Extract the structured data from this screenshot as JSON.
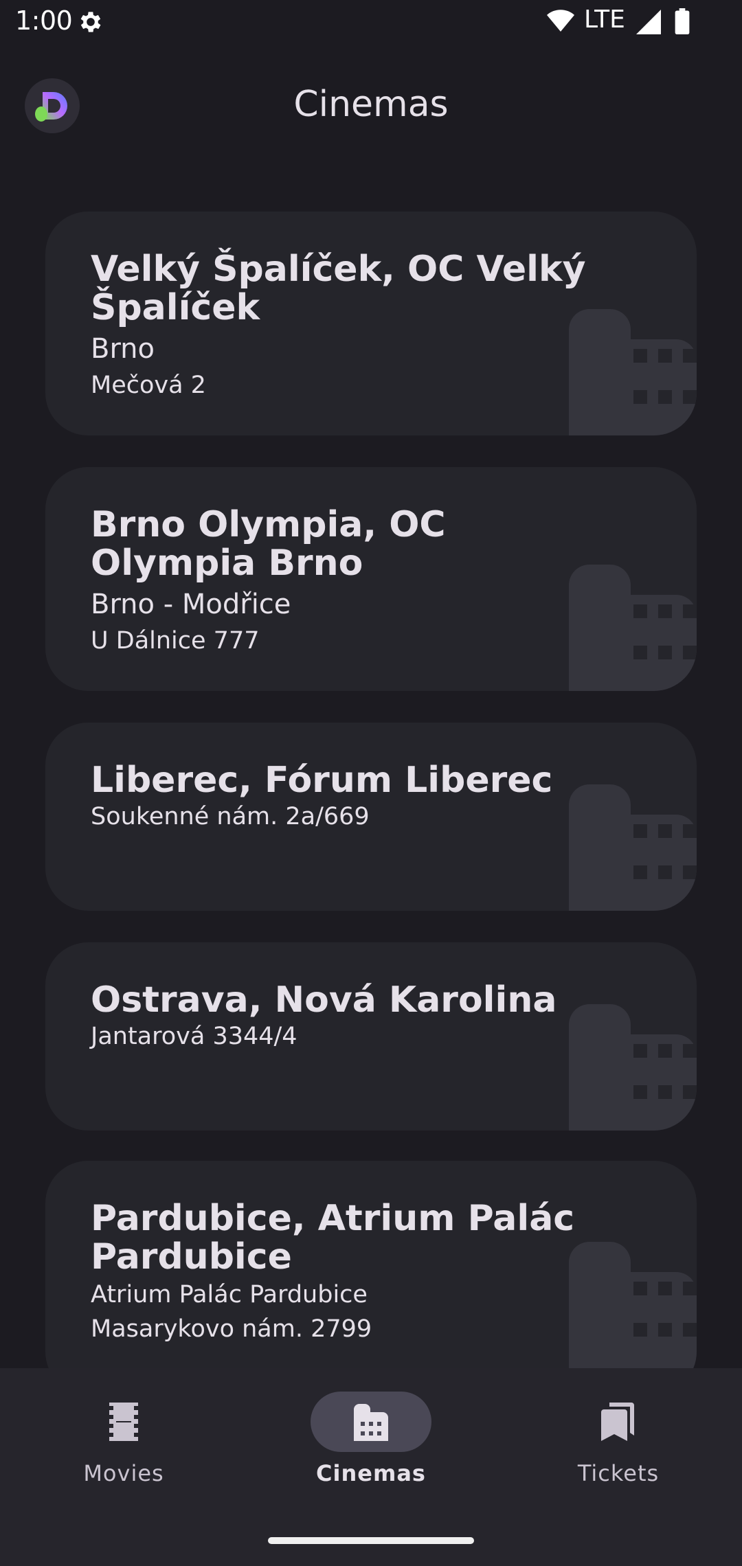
{
  "status_bar": {
    "time": "1:00",
    "network": "LTE"
  },
  "header": {
    "title": "Cinemas",
    "logo_icon": "app-logo-icon"
  },
  "cinemas": [
    {
      "title": "Velký Špalíček, OC Velký Špalíček",
      "city": "Brno",
      "address": "Mečová 2"
    },
    {
      "title": "Brno Olympia, OC Olympia Brno",
      "city": "Brno - Modřice",
      "address": "U Dálnice 777"
    },
    {
      "title": "Liberec, Fórum Liberec",
      "city": "",
      "address": "Soukenné nám. 2a/669"
    },
    {
      "title": "Ostrava, Nová Karolina",
      "city": "",
      "address": "Jantarová 3344/4"
    },
    {
      "title": "Pardubice, Atrium Palác Pardubice",
      "city": "Atrium Palác Pardubice",
      "address": "Masarykovo nám. 2799"
    }
  ],
  "bottom_nav": {
    "items": [
      {
        "label": "Movies",
        "icon": "film-icon",
        "active": false
      },
      {
        "label": "Cinemas",
        "icon": "cinema-building-icon",
        "active": true
      },
      {
        "label": "Tickets",
        "icon": "bookmark-icon",
        "active": false
      }
    ]
  },
  "colors": {
    "background": "#1c1b21",
    "card": "#25252b",
    "card_watermark": "#35353d",
    "nav_background": "#26252c",
    "nav_active_pill": "#4a4856",
    "text": "#e6e1e9"
  }
}
